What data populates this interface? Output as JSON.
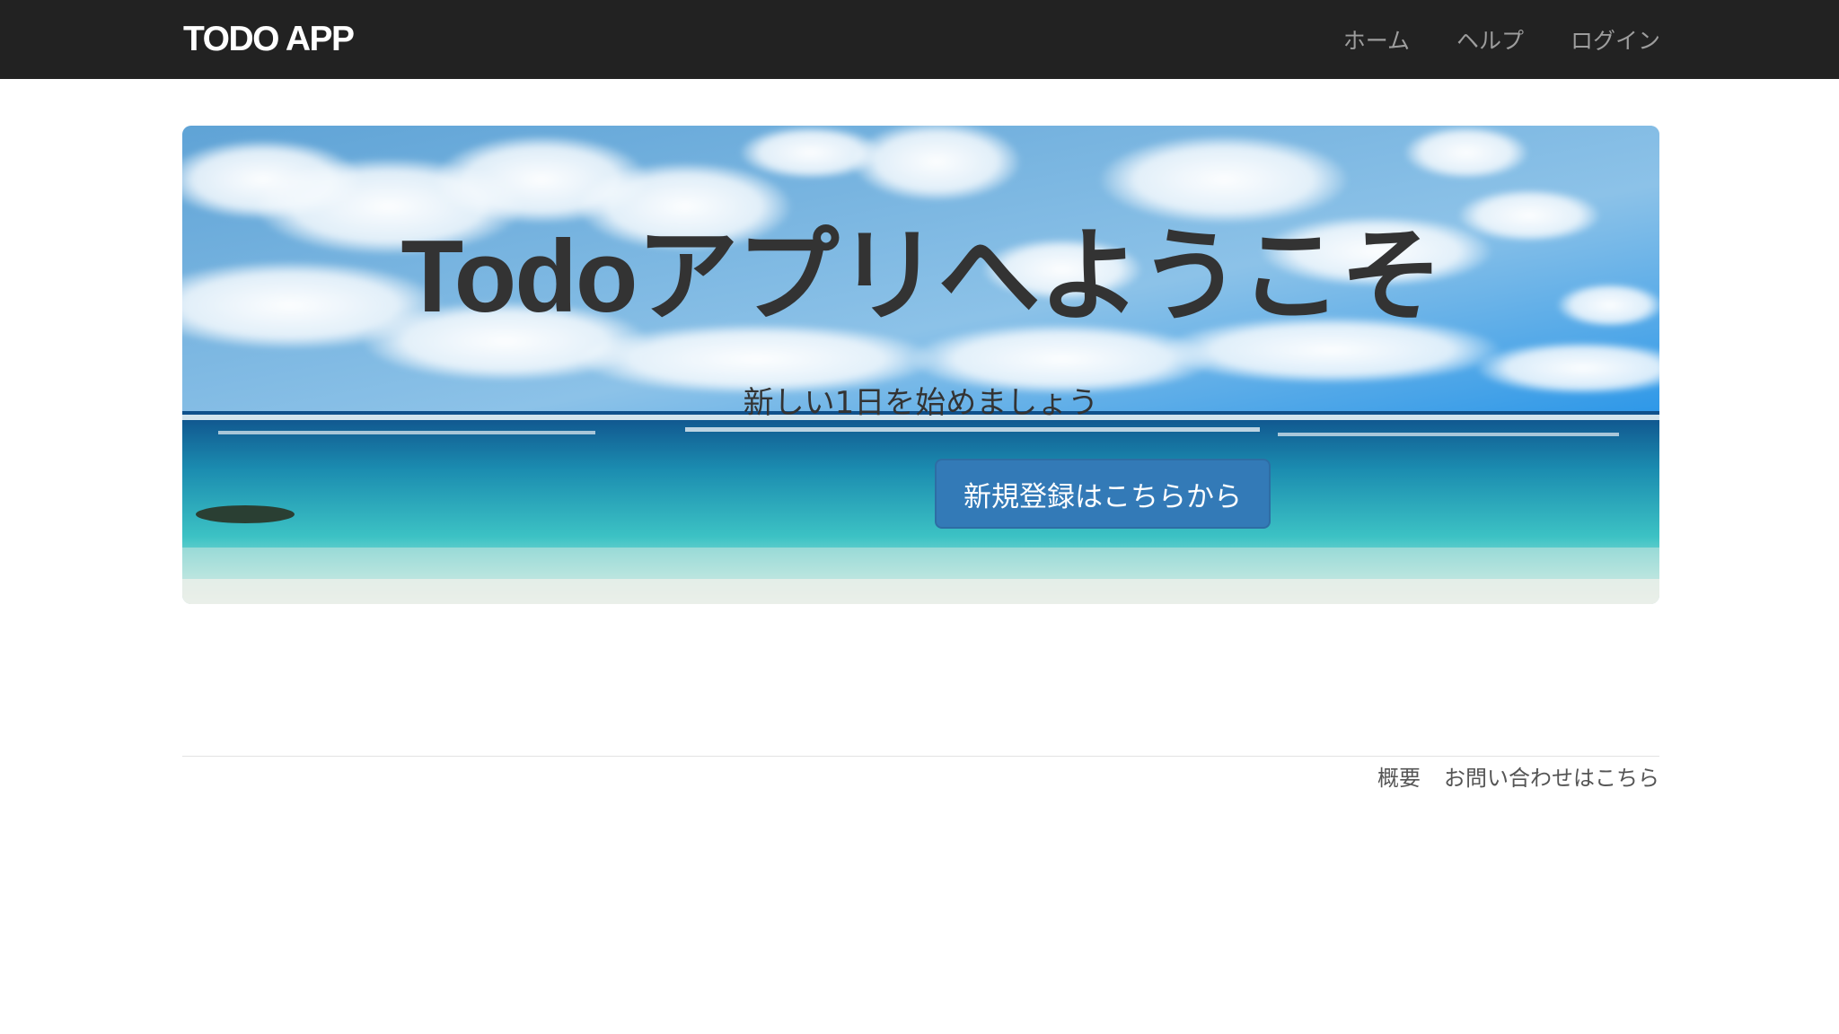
{
  "navbar": {
    "brand": "TODO APP",
    "items": [
      {
        "label": "ホーム"
      },
      {
        "label": "ヘルプ"
      },
      {
        "label": "ログイン"
      }
    ]
  },
  "hero": {
    "title": "Todoアプリへようこそ",
    "subtitle": "新しい1日を始めましょう",
    "button_label": "新規登録はこちらから",
    "background": "beach-ocean-sky-image"
  },
  "footer": {
    "links": [
      {
        "label": "概要"
      },
      {
        "label": "お問い合わせはこちら"
      }
    ]
  },
  "colors": {
    "navbar_bg": "#222222",
    "brand_text": "#ffffff",
    "nav_text": "#9d9d9d",
    "primary_button": "#337ab7",
    "hero_text": "#333333"
  }
}
